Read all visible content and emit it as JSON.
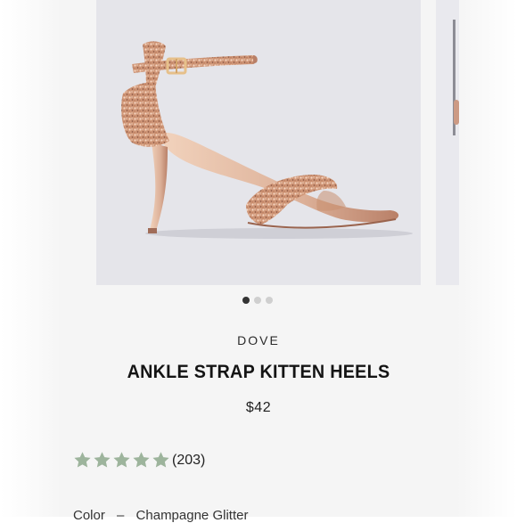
{
  "product": {
    "brand": "DOVE",
    "title": "ANKLE STRAP KITTEN HEELS",
    "price": "$42",
    "rating": {
      "stars": 5,
      "max_stars": 5,
      "review_count": "(203)",
      "star_color": "#9db49c"
    },
    "color": {
      "label": "Color",
      "separator": "–",
      "value": "Champagne Glitter"
    }
  },
  "carousel": {
    "slide_count": 3,
    "active_index": 0,
    "image_icon": "rose-gold-glitter-sandal"
  },
  "colors": {
    "panel_bg": "#f5f5f5",
    "image_bg": "#e5e5ea",
    "rose_gold": "#d8a688",
    "dot_active": "#333333",
    "dot_inactive": "#cfcfcf"
  }
}
